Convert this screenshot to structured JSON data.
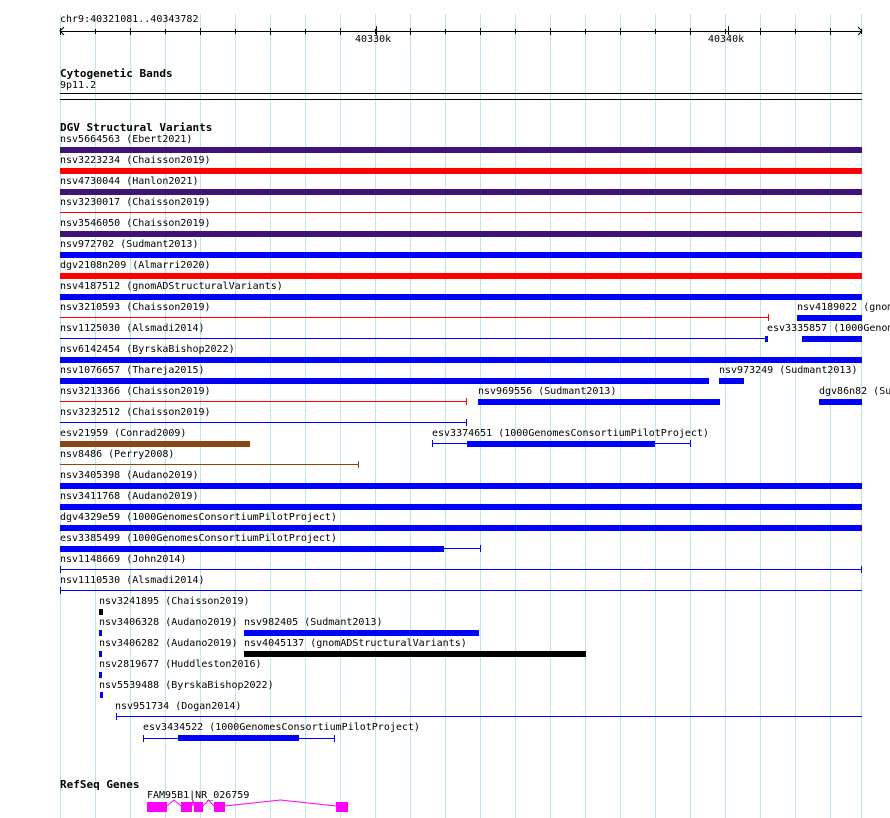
{
  "ruler": {
    "position_label": "chr9:40321081..40343782",
    "tick_labels": [
      "40330k",
      "40340k"
    ]
  },
  "cytoband": {
    "title": "Cytogenetic Bands",
    "band": "9p11.2"
  },
  "dgv": {
    "title": "DGV Structural Variants",
    "colors": {
      "purple": "#3f137a",
      "red": "#ff0000",
      "blue": "#0000ff",
      "brown": "#8b4513",
      "black": "#000000"
    },
    "labels": [
      "nsv5664563 (Ebert2021)",
      "nsv3223234 (Chaisson2019)",
      "nsv4730044 (Hanlon2021)",
      "nsv3230017 (Chaisson2019)",
      "nsv3546050 (Chaisson2019)",
      "nsv972702 (Sudmant2013)",
      "dgv2108n209 (Almarri2020)",
      "nsv4187512 (gnomADStructuralVariants)",
      "nsv3210593 (Chaisson2019)",
      "nsv4189022 (gnom",
      "nsv1125030 (Alsmadi2014)",
      "esv3335857 (1000Genom",
      "nsv6142454 (ByrskaBishop2022)",
      "nsv1076657 (Thareja2015)",
      "nsv973249 (Sudmant2013)",
      "nsv3213366 (Chaisson2019)",
      "nsv969556 (Sudmant2013)",
      "dgv86n82 (Su",
      "nsv3232512 (Chaisson2019)",
      "esv21959 (Conrad2009)",
      "esv3374651 (1000GenomesConsortiumPilotProject)",
      "nsv8486 (Perry2008)",
      "nsv3405398 (Audano2019)",
      "nsv3411768 (Audano2019)",
      "dgv4329e59 (1000GenomesConsortiumPilotProject)",
      "esv3385499 (1000GenomesConsortiumPilotProject)",
      "nsv1148669 (John2014)",
      "nsv1110530 (Alsmadi2014)",
      "nsv3241895 (Chaisson2019)",
      "nsv3406328 (Audano2019)",
      "nsv982405 (Sudmant2013)",
      "nsv3406282 (Audano2019)",
      "nsv4045137 (gnomADStructuralVariants)",
      "nsv2819677 (Huddleston2016)",
      "nsv5539488 (ByrskaBishop2022)",
      "nsv951734 (Dogan2014)",
      "esv3434522 (1000GenomesConsortiumPilotProject)"
    ]
  },
  "refseq": {
    "title": "RefSeq Genes",
    "gene_label": "FAM95B1|NR_026759",
    "color": "#ff00ff"
  }
}
